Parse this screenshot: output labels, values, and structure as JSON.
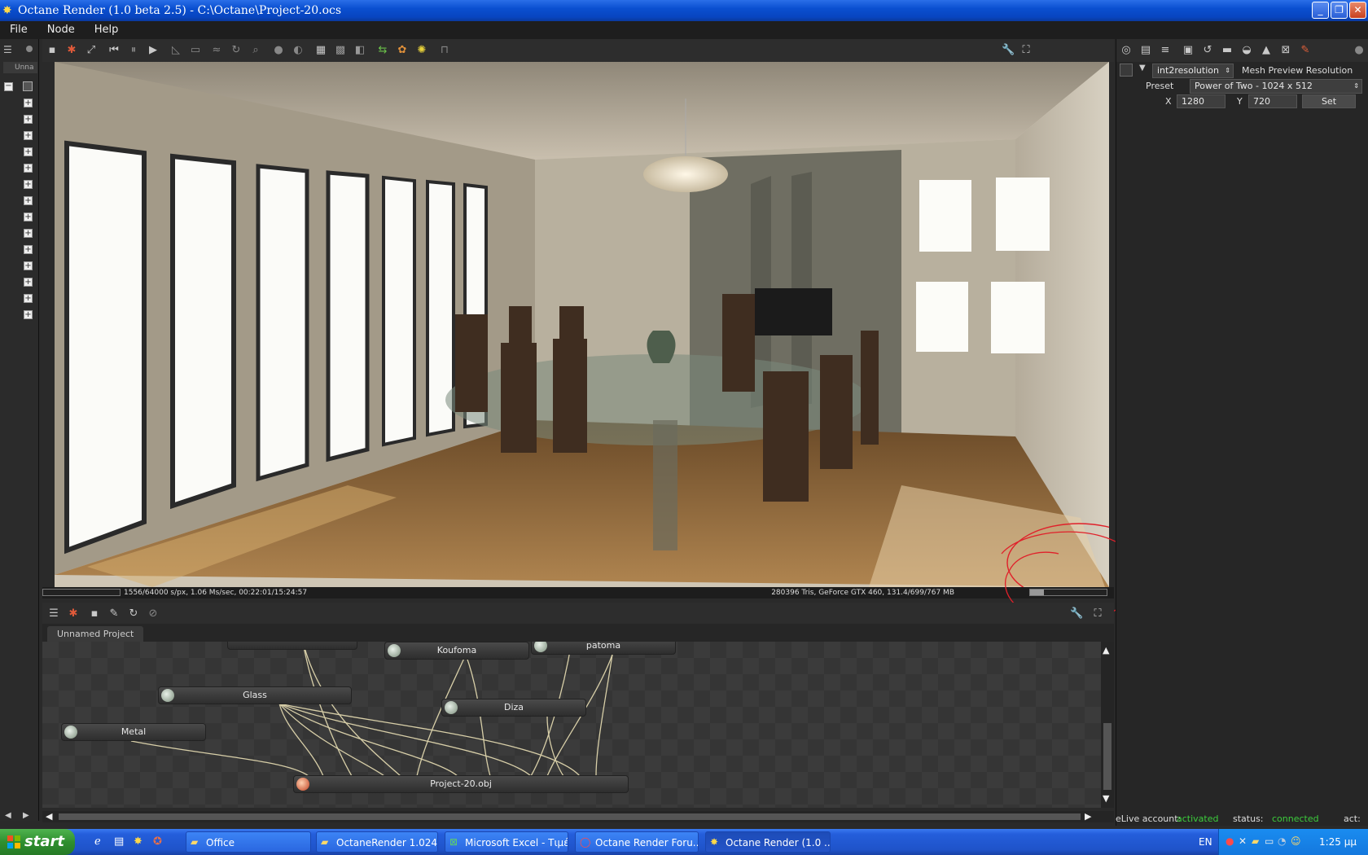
{
  "window": {
    "title": "Octane Render (1.0 beta 2.5) - C:\\Octane\\Project-20.ocs",
    "minimize_glyph": "_",
    "maximize_glyph": "❐",
    "close_glyph": "✕"
  },
  "menu": {
    "file": "File",
    "node": "Node",
    "help": "Help"
  },
  "left_panel": {
    "tab_label": "Unna"
  },
  "render_status": {
    "left": "1556/64000 s/px, 1.06 Ms/sec, 00:22:01/15:24:57",
    "right": "280396 Tris, GeForce GTX 460, 131.4/699/767 MB"
  },
  "graph": {
    "tab_label": "Unnamed Project",
    "nodes": {
      "koufoma": "Koufoma",
      "patoma": "patoma",
      "glass": "Glass",
      "diza": "Diza",
      "metal": "Metal",
      "project": "Project-20.obj"
    }
  },
  "right_panel": {
    "node_type": "int2resolution",
    "node_name": "Mesh Preview Resolution",
    "preset_label": "Preset",
    "preset_value": "Power of Two - 1024 x 512",
    "x_label": "X",
    "x_value": "1280",
    "y_label": "Y",
    "y_value": "720",
    "set_label": "Set"
  },
  "live_status": {
    "account_label": "eLive account:",
    "account_value": "activated",
    "status_label": "status:",
    "status_value": "connected",
    "act_label": "act:"
  },
  "taskbar": {
    "start": "start",
    "items": [
      {
        "label": "Office",
        "icon": "folder-icon"
      },
      {
        "label": "OctaneRender 1.024 ...",
        "icon": "folder-icon"
      },
      {
        "label": "Microsoft Excel - Τιμέ...",
        "icon": "excel-icon"
      },
      {
        "label": "Octane Render Foru...",
        "icon": "opera-icon"
      },
      {
        "label": "Octane Render (1.0 ...",
        "icon": "octane-icon"
      }
    ],
    "language": "EN",
    "clock": "1:25 μμ"
  },
  "colors": {
    "accent_green": "#3ccc3c",
    "annotation_red": "#e0202a"
  }
}
